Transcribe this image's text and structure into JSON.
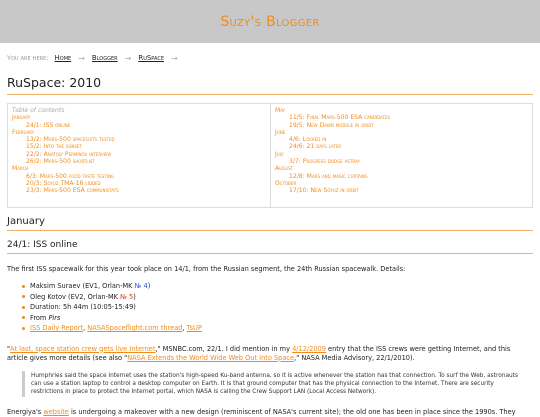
{
  "site": {
    "title": "Suzy's Blogger"
  },
  "breadcrumb": {
    "label": "You are here:",
    "items": [
      "Home",
      "Blogger",
      "RuSpace"
    ],
    "separator": "→"
  },
  "page": {
    "title": "RuSpace: 2010"
  },
  "toc": {
    "heading": "Table of contents",
    "left": [
      {
        "month": "January",
        "entries": [
          "24/1: ISS online"
        ]
      },
      {
        "month": "February",
        "entries": [
          "13/2: Mars-500 spacesuits tested",
          "15/2: Into the sunset",
          "22/2: Anatoly Perminov interview",
          "26/2: Mars-500 shortlist"
        ]
      },
      {
        "month": "March",
        "entries": [
          "6/3: Mars-500 food taste testing",
          "20/3: Soyuz TMA-16 lidded",
          "23/3: Mars-500 ESA communistats"
        ]
      }
    ],
    "right": [
      {
        "month": "May",
        "entries": [
          "11/5: Final Mars-500 ESA candidates",
          "19/5: New Dawn module in orbit"
        ]
      },
      {
        "month": "June",
        "entries": [
          "4/6: Locked in",
          "24/6: 21 days later"
        ]
      },
      {
        "month": "July",
        "entries": [
          "3/7: Progress dodge astray"
        ]
      },
      {
        "month": "August",
        "entries": [
          "12/8: Mars and magic curtains"
        ]
      },
      {
        "month": "October",
        "entries": [
          "17/10: New Soyuz in orbit"
        ]
      }
    ]
  },
  "section": {
    "title": "January"
  },
  "post": {
    "title": "24/1: ISS online",
    "intro": "The first ISS spacewalk for this year took place on 14/1, from the Russian segment, the 24th Russian spacewalk. Details:",
    "details": {
      "d1_text": "Maksim Suraev (EV1, Orlan-MK ",
      "d1_num": "№ 4",
      "d1_close": ")",
      "d2_text": "Oleg Kotov (EV2, Orlan-MK ",
      "d2_num": "№ 5",
      "d2_close": ")",
      "d3": "Duration: 5h 44m (10:05-15:49)",
      "d4_prefix": "From ",
      "d4_em": "Pirs",
      "d5_link1": "ISS Daily Report",
      "d5_sep1": ", ",
      "d5_link2": "NASASpaceflight.com thread",
      "d5_sep2": ", ",
      "d5_link3": "TsUP"
    },
    "para2": {
      "q_open": "\"",
      "link1": "At last, space station crew gets live Internet",
      "t1": ",\" MSNBC.com, 22/1. I did mention in my ",
      "link2": "4/12/2009",
      "t2": " entry that the ISS crews were getting Internet, and this article gives more details (see also \"",
      "link3": "NASA Extends the World Wide Web Out Into Space",
      "t3": ",\" NASA Media Advisory, 22/1/2010)."
    },
    "quote": "Humphries said the space Internet uses the station's high-speed Ku-band antenna, so it is active whenever the station has that connection. To surf the Web, astronauts can use a station laptop to control a desktop computer on Earth. It is that ground computer that has the physical connection to the Internet. There are security restrictions in place to protect the Internet portal, which NASA is calling the Crew Support LAN (Local Access Network).",
    "para3": {
      "t1": "Energiya's ",
      "link1": "website",
      "t2": " is undergoing a makeover with a new design (reminiscent of NASA's current site); the old one has been in place since the 1990s. They"
    }
  }
}
